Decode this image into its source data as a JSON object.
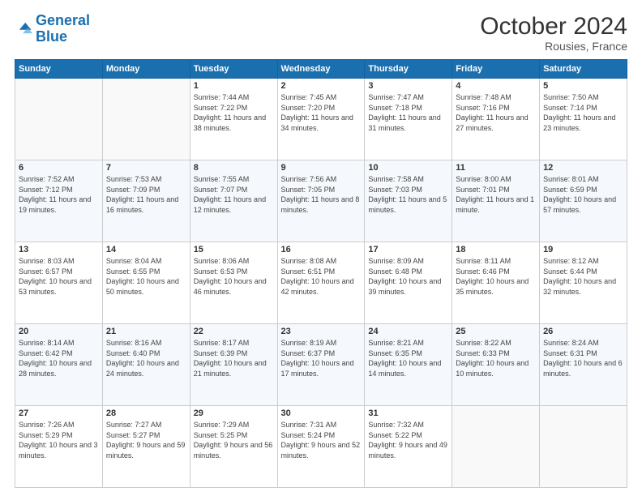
{
  "header": {
    "logo_line1": "General",
    "logo_line2": "Blue",
    "month": "October 2024",
    "location": "Rousies, France"
  },
  "weekdays": [
    "Sunday",
    "Monday",
    "Tuesday",
    "Wednesday",
    "Thursday",
    "Friday",
    "Saturday"
  ],
  "weeks": [
    [
      {
        "day": "",
        "info": ""
      },
      {
        "day": "",
        "info": ""
      },
      {
        "day": "1",
        "info": "Sunrise: 7:44 AM\nSunset: 7:22 PM\nDaylight: 11 hours and 38 minutes."
      },
      {
        "day": "2",
        "info": "Sunrise: 7:45 AM\nSunset: 7:20 PM\nDaylight: 11 hours and 34 minutes."
      },
      {
        "day": "3",
        "info": "Sunrise: 7:47 AM\nSunset: 7:18 PM\nDaylight: 11 hours and 31 minutes."
      },
      {
        "day": "4",
        "info": "Sunrise: 7:48 AM\nSunset: 7:16 PM\nDaylight: 11 hours and 27 minutes."
      },
      {
        "day": "5",
        "info": "Sunrise: 7:50 AM\nSunset: 7:14 PM\nDaylight: 11 hours and 23 minutes."
      }
    ],
    [
      {
        "day": "6",
        "info": "Sunrise: 7:52 AM\nSunset: 7:12 PM\nDaylight: 11 hours and 19 minutes."
      },
      {
        "day": "7",
        "info": "Sunrise: 7:53 AM\nSunset: 7:09 PM\nDaylight: 11 hours and 16 minutes."
      },
      {
        "day": "8",
        "info": "Sunrise: 7:55 AM\nSunset: 7:07 PM\nDaylight: 11 hours and 12 minutes."
      },
      {
        "day": "9",
        "info": "Sunrise: 7:56 AM\nSunset: 7:05 PM\nDaylight: 11 hours and 8 minutes."
      },
      {
        "day": "10",
        "info": "Sunrise: 7:58 AM\nSunset: 7:03 PM\nDaylight: 11 hours and 5 minutes."
      },
      {
        "day": "11",
        "info": "Sunrise: 8:00 AM\nSunset: 7:01 PM\nDaylight: 11 hours and 1 minute."
      },
      {
        "day": "12",
        "info": "Sunrise: 8:01 AM\nSunset: 6:59 PM\nDaylight: 10 hours and 57 minutes."
      }
    ],
    [
      {
        "day": "13",
        "info": "Sunrise: 8:03 AM\nSunset: 6:57 PM\nDaylight: 10 hours and 53 minutes."
      },
      {
        "day": "14",
        "info": "Sunrise: 8:04 AM\nSunset: 6:55 PM\nDaylight: 10 hours and 50 minutes."
      },
      {
        "day": "15",
        "info": "Sunrise: 8:06 AM\nSunset: 6:53 PM\nDaylight: 10 hours and 46 minutes."
      },
      {
        "day": "16",
        "info": "Sunrise: 8:08 AM\nSunset: 6:51 PM\nDaylight: 10 hours and 42 minutes."
      },
      {
        "day": "17",
        "info": "Sunrise: 8:09 AM\nSunset: 6:48 PM\nDaylight: 10 hours and 39 minutes."
      },
      {
        "day": "18",
        "info": "Sunrise: 8:11 AM\nSunset: 6:46 PM\nDaylight: 10 hours and 35 minutes."
      },
      {
        "day": "19",
        "info": "Sunrise: 8:12 AM\nSunset: 6:44 PM\nDaylight: 10 hours and 32 minutes."
      }
    ],
    [
      {
        "day": "20",
        "info": "Sunrise: 8:14 AM\nSunset: 6:42 PM\nDaylight: 10 hours and 28 minutes."
      },
      {
        "day": "21",
        "info": "Sunrise: 8:16 AM\nSunset: 6:40 PM\nDaylight: 10 hours and 24 minutes."
      },
      {
        "day": "22",
        "info": "Sunrise: 8:17 AM\nSunset: 6:39 PM\nDaylight: 10 hours and 21 minutes."
      },
      {
        "day": "23",
        "info": "Sunrise: 8:19 AM\nSunset: 6:37 PM\nDaylight: 10 hours and 17 minutes."
      },
      {
        "day": "24",
        "info": "Sunrise: 8:21 AM\nSunset: 6:35 PM\nDaylight: 10 hours and 14 minutes."
      },
      {
        "day": "25",
        "info": "Sunrise: 8:22 AM\nSunset: 6:33 PM\nDaylight: 10 hours and 10 minutes."
      },
      {
        "day": "26",
        "info": "Sunrise: 8:24 AM\nSunset: 6:31 PM\nDaylight: 10 hours and 6 minutes."
      }
    ],
    [
      {
        "day": "27",
        "info": "Sunrise: 7:26 AM\nSunset: 5:29 PM\nDaylight: 10 hours and 3 minutes."
      },
      {
        "day": "28",
        "info": "Sunrise: 7:27 AM\nSunset: 5:27 PM\nDaylight: 9 hours and 59 minutes."
      },
      {
        "day": "29",
        "info": "Sunrise: 7:29 AM\nSunset: 5:25 PM\nDaylight: 9 hours and 56 minutes."
      },
      {
        "day": "30",
        "info": "Sunrise: 7:31 AM\nSunset: 5:24 PM\nDaylight: 9 hours and 52 minutes."
      },
      {
        "day": "31",
        "info": "Sunrise: 7:32 AM\nSunset: 5:22 PM\nDaylight: 9 hours and 49 minutes."
      },
      {
        "day": "",
        "info": ""
      },
      {
        "day": "",
        "info": ""
      }
    ]
  ]
}
